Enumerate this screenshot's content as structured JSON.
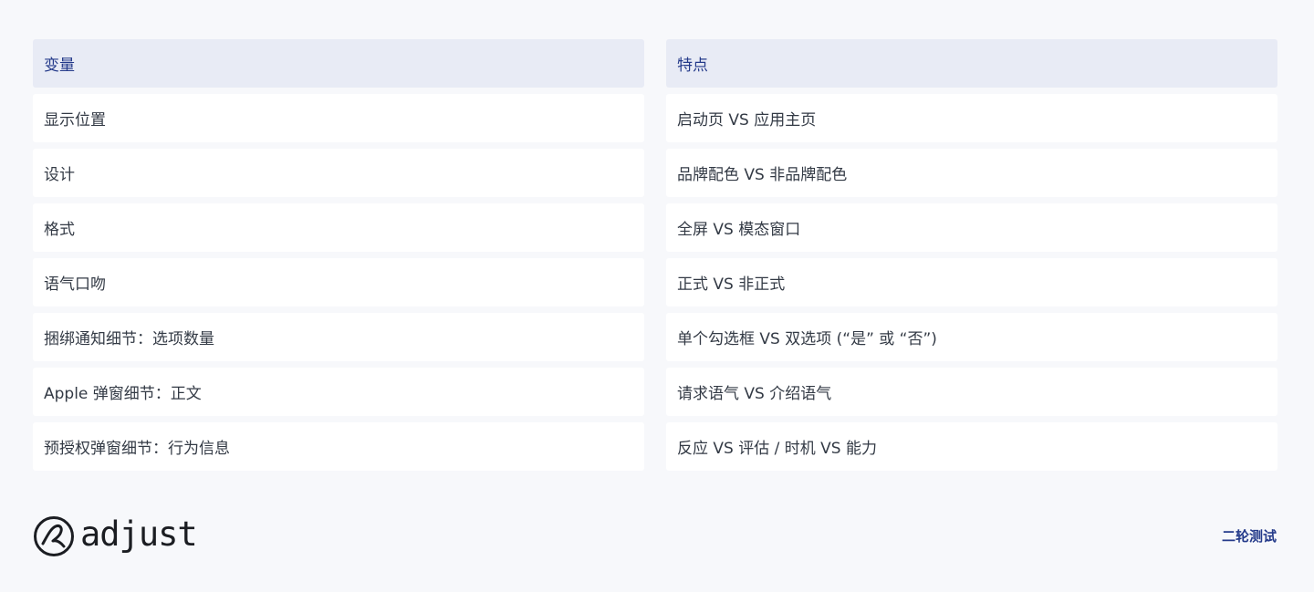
{
  "table": {
    "headers": [
      "变量",
      "特点"
    ],
    "rows": [
      [
        "显示位置",
        "启动页 VS 应用主页"
      ],
      [
        "设计",
        "品牌配色 VS 非品牌配色"
      ],
      [
        "格式",
        "全屏 VS 模态窗口"
      ],
      [
        "语气口吻",
        "正式 VS 非正式"
      ],
      [
        "捆绑通知细节：选项数量",
        "单个勾选框 VS 双选项 (“是” 或 “否”)"
      ],
      [
        "Apple 弹窗细节：正文",
        "请求语气 VS 介绍语气"
      ],
      [
        "预授权弹窗细节：行为信息",
        "反应 VS 评估 / 时机 VS 能力"
      ]
    ]
  },
  "footer": {
    "logo_text": "adjust",
    "logo_icon": "adjust-logo-icon",
    "right_label": "二轮测试"
  },
  "colors": {
    "background": "#f7f8fb",
    "header_bg": "#e8ebf5",
    "header_text": "#243a8a",
    "row_bg": "#ffffff",
    "accent": "#243a8a"
  }
}
